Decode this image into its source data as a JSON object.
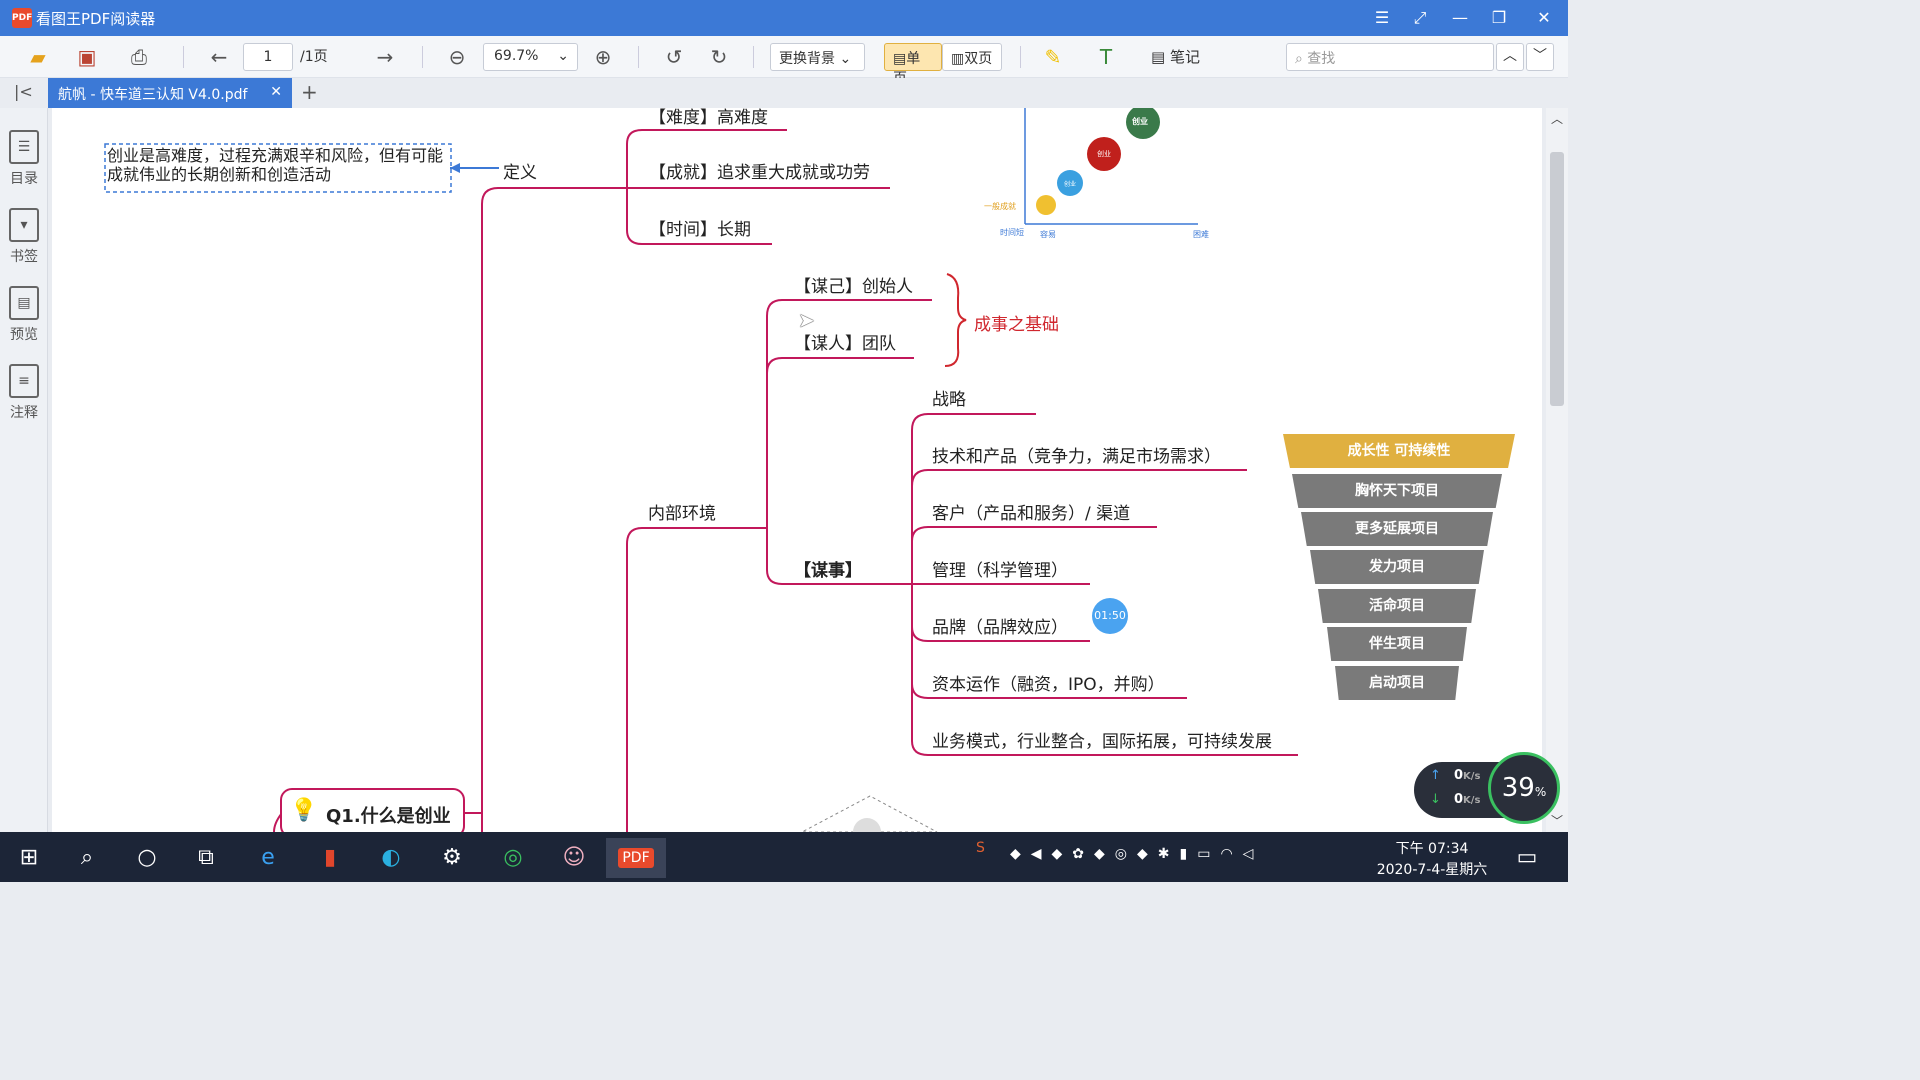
{
  "window": {
    "title": "看图王PDF阅读器",
    "logo_text": "PDF"
  },
  "toolbar": {
    "page_value": "1",
    "page_total": "/1页",
    "zoom": "69.7%",
    "bg_label": "更换背景",
    "single_label": "单页",
    "double_label": "双页",
    "note_label": "笔记",
    "search_placeholder": "查找"
  },
  "tab": {
    "name": "航帆 - 快车道三认知 V4.0.pdf"
  },
  "sidebar": {
    "items": [
      {
        "label": "目录"
      },
      {
        "label": "书签"
      },
      {
        "label": "预览"
      },
      {
        "label": "注释"
      }
    ]
  },
  "mindmap": {
    "definition_box": "创业是高难度，过程充满艰辛和风险，但有可能成就伟业的长期创新和创造活动",
    "definition_label": "定义",
    "def_items": [
      "【难度】高难度",
      "【成就】追求重大成就或功劳",
      "【时间】长期"
    ],
    "inner_env": "内部环境",
    "self_item": "【谋己】创始人",
    "people_item": "【谋人】团队",
    "foundation": "成事之基础",
    "affairs": "【谋事】",
    "affair_items": [
      "战略",
      "技术和产品（竞争力，满足市场需求）",
      "客户（产品和服务）/ 渠道",
      "管理（科学管理）",
      "品牌（品牌效应）",
      "资本运作（融资，IPO，并购）",
      "业务模式，行业整合，国际拓展，可持续发展"
    ],
    "root": "Q1.什么是创业",
    "timer": "01:50"
  },
  "bubble_chart": {
    "labels": [
      "创业",
      "创业",
      "创业",
      "一般成就",
      "时间短",
      "容易",
      "困难"
    ]
  },
  "funnel": {
    "top": "成长性 可持续性",
    "steps": [
      "胸怀天下项目",
      "更多延展项目",
      "发力项目",
      "活命项目",
      "伴生项目",
      "启动项目"
    ],
    "colors": {
      "top": "#e0b040",
      "step": "#7a7a7a"
    }
  },
  "netspeed": {
    "up": "0",
    "down": "0",
    "unit": "K/s",
    "cpu": "39",
    "cpu_unit": "%"
  },
  "taskbar": {
    "time": "下午 07:34",
    "date": "2020-7-4-星期六"
  }
}
